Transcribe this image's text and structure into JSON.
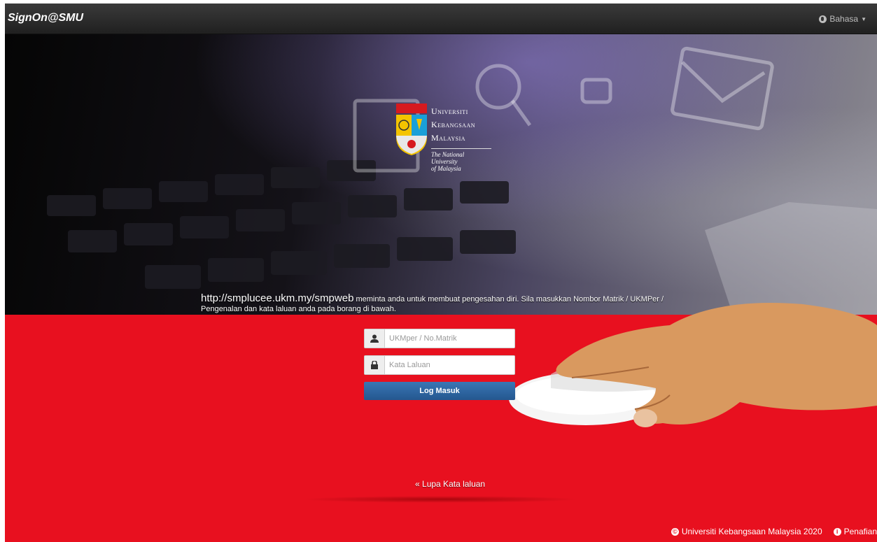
{
  "navbar": {
    "brand": "SignOn@SMU",
    "language_label": "Bahasa"
  },
  "logo": {
    "line1": "Universiti",
    "line2": "Kebangsaan",
    "line3": "Malaysia",
    "sub1": "The National University",
    "sub2": "of Malaysia"
  },
  "message": {
    "url": "http://smplucee.ukm.my/smpweb",
    "text": " meminta anda untuk membuat pengesahan diri. Sila masukkan Nombor Matrik / UKMPer / Pengenalan dan kata laluan anda pada borang di bawah."
  },
  "login": {
    "username_placeholder": "UKMper / No.Matrik",
    "password_placeholder": "Kata Laluan",
    "submit_label": "Log Masuk"
  },
  "forgot": {
    "chevron": "«",
    "label": "Lupa Kata laluan"
  },
  "footer": {
    "copyright": "Universiti Kebangsaan Malaysia 2020",
    "disclaimer": "Penafian"
  },
  "colors": {
    "background_red": "#e8101f",
    "navbar": "#2a2a2a",
    "button_blue": "#2d66a3"
  },
  "icons": [
    "globe-icon",
    "user-icon",
    "lock-icon",
    "copyright-icon",
    "info-icon"
  ]
}
